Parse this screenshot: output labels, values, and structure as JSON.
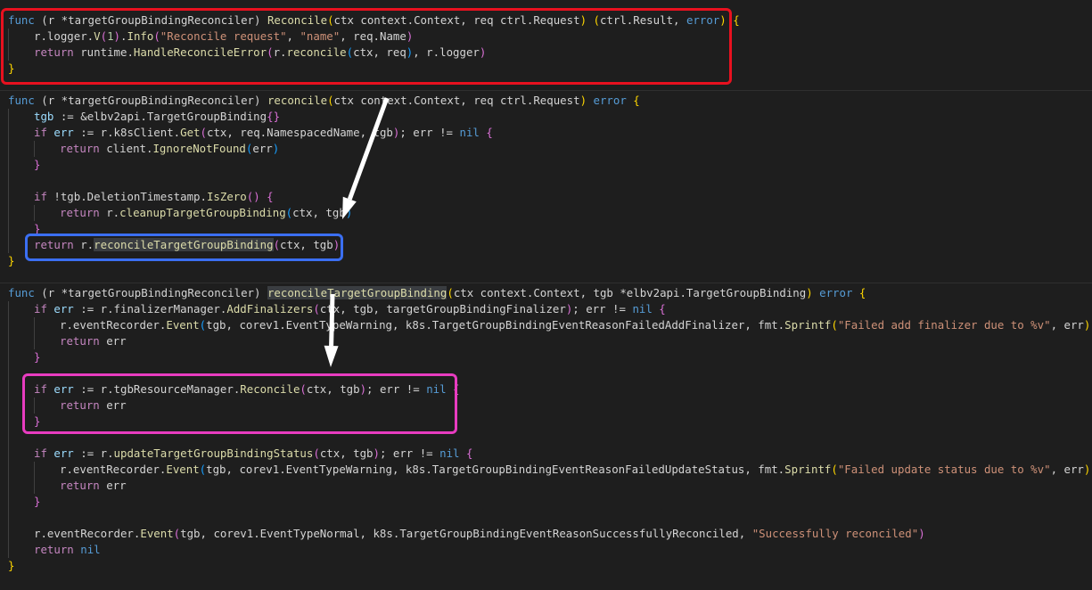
{
  "colors": {
    "background": "#1e1e1e",
    "keyword": "#569cd6",
    "control": "#c586c0",
    "function": "#dcdcaa",
    "string": "#ce9178",
    "number": "#b5cea8",
    "variable": "#9cdcfe",
    "text": "#d4d4d4",
    "red_box": "#e8111f",
    "blue_box": "#3b6ff2",
    "magenta_box": "#e83cc0",
    "arrow": "#ffffff"
  },
  "annotations": {
    "red_box": "highlights Reconcile method",
    "blue_box": "highlights return r.reconcileTargetGroupBinding(ctx, tgb)",
    "magenta_box": "highlights tgbResourceManager.Reconcile call",
    "arrow_icons": [
      "arrow-down-left-icon",
      "arrow-down-icon"
    ]
  },
  "lines": [
    {
      "indent": 0,
      "text": "func (r *targetGroupBindingReconciler) Reconcile(ctx context.Context, req ctrl.Request) (ctrl.Result, error) {",
      "tokens": [
        [
          "func",
          "kw"
        ],
        [
          " (r *targetGroupBindingReconciler) ",
          ""
        ],
        [
          "Reconcile",
          "fn"
        ],
        [
          "(",
          "b1"
        ],
        [
          "ctx context.Context, req ctrl.Request",
          ""
        ],
        [
          ")",
          "b1"
        ],
        [
          " ",
          ""
        ],
        [
          "(",
          "b1"
        ],
        [
          "ctrl.Result, ",
          ""
        ],
        [
          "error",
          "kw"
        ],
        [
          ")",
          "b1"
        ],
        [
          " ",
          ""
        ],
        [
          "{",
          "b1"
        ]
      ]
    },
    {
      "indent": 1,
      "text": "r.logger.V(1).Info(\"Reconcile request\", \"name\", req.Name)",
      "tokens": [
        [
          "r.logger.",
          ""
        ],
        [
          "V",
          "fn"
        ],
        [
          "(",
          "b2"
        ],
        [
          "1",
          "num"
        ],
        [
          ")",
          "b2"
        ],
        [
          ".",
          ""
        ],
        [
          "Info",
          "fn"
        ],
        [
          "(",
          "b2"
        ],
        [
          "\"Reconcile request\"",
          "str"
        ],
        [
          ", ",
          ""
        ],
        [
          "\"name\"",
          "str"
        ],
        [
          ", req.Name",
          ""
        ],
        [
          ")",
          "b2"
        ]
      ]
    },
    {
      "indent": 1,
      "text": "return runtime.HandleReconcileError(r.reconcile(ctx, req), r.logger)",
      "tokens": [
        [
          "return",
          "ctl"
        ],
        [
          " runtime.",
          ""
        ],
        [
          "HandleReconcileError",
          "fn"
        ],
        [
          "(",
          "b2"
        ],
        [
          "r.",
          ""
        ],
        [
          "reconcile",
          "fn"
        ],
        [
          "(",
          "b3"
        ],
        [
          "ctx, req",
          ""
        ],
        [
          ")",
          "b3"
        ],
        [
          ", r.logger",
          ""
        ],
        [
          ")",
          "b2"
        ]
      ]
    },
    {
      "indent": 0,
      "text": "}",
      "tokens": [
        [
          "}",
          "b1"
        ]
      ]
    },
    {
      "indent": 0,
      "text": "",
      "tokens": []
    },
    {
      "indent": 0,
      "text": "func (r *targetGroupBindingReconciler) reconcile(ctx context.Context, req ctrl.Request) error {",
      "tokens": [
        [
          "func",
          "kw"
        ],
        [
          " (r *targetGroupBindingReconciler) ",
          ""
        ],
        [
          "reconcile",
          "fn"
        ],
        [
          "(",
          "b1"
        ],
        [
          "ctx context.Context, req ctrl.Request",
          ""
        ],
        [
          ")",
          "b1"
        ],
        [
          " ",
          ""
        ],
        [
          "error",
          "kw"
        ],
        [
          " ",
          ""
        ],
        [
          "{",
          "b1"
        ]
      ]
    },
    {
      "indent": 1,
      "text": "tgb := &elbv2api.TargetGroupBinding{}",
      "tokens": [
        [
          "tgb",
          "var"
        ],
        [
          " := &elbv2api.TargetGroupBinding",
          ""
        ],
        [
          "{}",
          "b2"
        ]
      ]
    },
    {
      "indent": 1,
      "text": "if err := r.k8sClient.Get(ctx, req.NamespacedName, tgb); err != nil {",
      "tokens": [
        [
          "if",
          "ctl"
        ],
        [
          " ",
          ""
        ],
        [
          "err",
          "var"
        ],
        [
          " := r.k8sClient.",
          ""
        ],
        [
          "Get",
          "fn"
        ],
        [
          "(",
          "b2"
        ],
        [
          "ctx, req.NamespacedName, tgb",
          ""
        ],
        [
          ")",
          "b2"
        ],
        [
          "; err != ",
          ""
        ],
        [
          "nil",
          "kw"
        ],
        [
          " ",
          ""
        ],
        [
          "{",
          "b2"
        ]
      ]
    },
    {
      "indent": 2,
      "text": "return client.IgnoreNotFound(err)",
      "tokens": [
        [
          "return",
          "ctl"
        ],
        [
          " client.",
          ""
        ],
        [
          "IgnoreNotFound",
          "fn"
        ],
        [
          "(",
          "b3"
        ],
        [
          "err",
          ""
        ],
        [
          ")",
          "b3"
        ]
      ]
    },
    {
      "indent": 1,
      "text": "}",
      "tokens": [
        [
          "}",
          "b2"
        ]
      ]
    },
    {
      "indent": 1,
      "text": "",
      "tokens": []
    },
    {
      "indent": 1,
      "text": "if !tgb.DeletionTimestamp.IsZero() {",
      "tokens": [
        [
          "if",
          "ctl"
        ],
        [
          " !tgb.DeletionTimestamp.",
          ""
        ],
        [
          "IsZero",
          "fn"
        ],
        [
          "()",
          "b2"
        ],
        [
          " ",
          ""
        ],
        [
          "{",
          "b2"
        ]
      ]
    },
    {
      "indent": 2,
      "text": "return r.cleanupTargetGroupBinding(ctx, tgb)",
      "tokens": [
        [
          "return",
          "ctl"
        ],
        [
          " r.",
          ""
        ],
        [
          "cleanupTargetGroupBinding",
          "fn"
        ],
        [
          "(",
          "b3"
        ],
        [
          "ctx, tgb",
          ""
        ],
        [
          ")",
          "b3"
        ]
      ]
    },
    {
      "indent": 1,
      "text": "}",
      "tokens": [
        [
          "}",
          "b2"
        ]
      ]
    },
    {
      "indent": 1,
      "text": "return r.reconcileTargetGroupBinding(ctx, tgb)",
      "tokens": [
        [
          "return",
          "ctl"
        ],
        [
          " r.",
          ""
        ],
        [
          "reconcileTargetGroupBinding",
          "fn hl"
        ],
        [
          "(",
          "b2"
        ],
        [
          "ctx, tgb",
          ""
        ],
        [
          ")",
          "b2"
        ]
      ]
    },
    {
      "indent": 0,
      "text": "}",
      "tokens": [
        [
          "}",
          "b1"
        ]
      ]
    },
    {
      "indent": 0,
      "text": "",
      "tokens": []
    },
    {
      "indent": 0,
      "text": "func (r *targetGroupBindingReconciler) reconcileTargetGroupBinding(ctx context.Context, tgb *elbv2api.TargetGroupBinding) error {",
      "tokens": [
        [
          "func",
          "kw"
        ],
        [
          " (r *targetGroupBindingReconciler) ",
          ""
        ],
        [
          "reconcileTargetGroupBinding",
          "fn hl"
        ],
        [
          "(",
          "b1"
        ],
        [
          "ctx context.Context, tgb *elbv2api.TargetGroupBinding",
          ""
        ],
        [
          ")",
          "b1"
        ],
        [
          " ",
          ""
        ],
        [
          "error",
          "kw"
        ],
        [
          " ",
          ""
        ],
        [
          "{",
          "b1"
        ]
      ]
    },
    {
      "indent": 1,
      "text": "if err := r.finalizerManager.AddFinalizers(ctx, tgb, targetGroupBindingFinalizer); err != nil {",
      "tokens": [
        [
          "if",
          "ctl"
        ],
        [
          " ",
          ""
        ],
        [
          "err",
          "var"
        ],
        [
          " := r.finalizerManager.",
          ""
        ],
        [
          "AddFinalizers",
          "fn"
        ],
        [
          "(",
          "b2"
        ],
        [
          "ctx, tgb, targetGroupBindingFinalizer",
          ""
        ],
        [
          ")",
          "b2"
        ],
        [
          "; err != ",
          ""
        ],
        [
          "nil",
          "kw"
        ],
        [
          " ",
          ""
        ],
        [
          "{",
          "b2"
        ]
      ]
    },
    {
      "indent": 2,
      "text": "r.eventRecorder.Event(tgb, corev1.EventTypeWarning, k8s.TargetGroupBindingEventReasonFailedAddFinalizer, fmt.Sprintf(\"Failed add finalizer due to %v\", err))",
      "tokens": [
        [
          "r.eventRecorder.",
          ""
        ],
        [
          "Event",
          "fn"
        ],
        [
          "(",
          "b3"
        ],
        [
          "tgb, corev1.EventTypeWarning, k8s.TargetGroupBindingEventReasonFailedAddFinalizer, fmt.",
          ""
        ],
        [
          "Sprintf",
          "fn"
        ],
        [
          "(",
          "b1"
        ],
        [
          "\"Failed add finalizer due to %v\"",
          "str"
        ],
        [
          ", err",
          ""
        ],
        [
          ")",
          "b1"
        ],
        [
          ")",
          "b3"
        ]
      ]
    },
    {
      "indent": 2,
      "text": "return err",
      "tokens": [
        [
          "return",
          "ctl"
        ],
        [
          " err",
          ""
        ]
      ]
    },
    {
      "indent": 1,
      "text": "}",
      "tokens": [
        [
          "}",
          "b2"
        ]
      ]
    },
    {
      "indent": 1,
      "text": "",
      "tokens": []
    },
    {
      "indent": 1,
      "text": "if err := r.tgbResourceManager.Reconcile(ctx, tgb); err != nil {",
      "tokens": [
        [
          "if",
          "ctl"
        ],
        [
          " ",
          ""
        ],
        [
          "err",
          "var"
        ],
        [
          " := r.tgbResourceManager.",
          ""
        ],
        [
          "Reconcile",
          "fn"
        ],
        [
          "(",
          "b2"
        ],
        [
          "ctx, tgb",
          ""
        ],
        [
          ")",
          "b2"
        ],
        [
          "; err != ",
          ""
        ],
        [
          "nil",
          "kw"
        ],
        [
          " ",
          ""
        ],
        [
          "{",
          "b2"
        ]
      ]
    },
    {
      "indent": 2,
      "text": "return err",
      "tokens": [
        [
          "return",
          "ctl"
        ],
        [
          " err",
          ""
        ]
      ]
    },
    {
      "indent": 1,
      "text": "}",
      "tokens": [
        [
          "}",
          "b2"
        ]
      ]
    },
    {
      "indent": 1,
      "text": "",
      "tokens": []
    },
    {
      "indent": 1,
      "text": "if err := r.updateTargetGroupBindingStatus(ctx, tgb); err != nil {",
      "tokens": [
        [
          "if",
          "ctl"
        ],
        [
          " ",
          ""
        ],
        [
          "err",
          "var"
        ],
        [
          " := r.",
          ""
        ],
        [
          "updateTargetGroupBindingStatus",
          "fn"
        ],
        [
          "(",
          "b2"
        ],
        [
          "ctx, tgb",
          ""
        ],
        [
          ")",
          "b2"
        ],
        [
          "; err != ",
          ""
        ],
        [
          "nil",
          "kw"
        ],
        [
          " ",
          ""
        ],
        [
          "{",
          "b2"
        ]
      ]
    },
    {
      "indent": 2,
      "text": "r.eventRecorder.Event(tgb, corev1.EventTypeWarning, k8s.TargetGroupBindingEventReasonFailedUpdateStatus, fmt.Sprintf(\"Failed update status due to %v\", err))",
      "tokens": [
        [
          "r.eventRecorder.",
          ""
        ],
        [
          "Event",
          "fn"
        ],
        [
          "(",
          "b3"
        ],
        [
          "tgb, corev1.EventTypeWarning, k8s.TargetGroupBindingEventReasonFailedUpdateStatus, fmt.",
          ""
        ],
        [
          "Sprintf",
          "fn"
        ],
        [
          "(",
          "b1"
        ],
        [
          "\"Failed update status due to %v\"",
          "str"
        ],
        [
          ", err",
          ""
        ],
        [
          ")",
          "b1"
        ],
        [
          ")",
          "b3"
        ]
      ]
    },
    {
      "indent": 2,
      "text": "return err",
      "tokens": [
        [
          "return",
          "ctl"
        ],
        [
          " err",
          ""
        ]
      ]
    },
    {
      "indent": 1,
      "text": "}",
      "tokens": [
        [
          "}",
          "b2"
        ]
      ]
    },
    {
      "indent": 1,
      "text": "",
      "tokens": []
    },
    {
      "indent": 1,
      "text": "r.eventRecorder.Event(tgb, corev1.EventTypeNormal, k8s.TargetGroupBindingEventReasonSuccessfullyReconciled, \"Successfully reconciled\")",
      "tokens": [
        [
          "r.eventRecorder.",
          ""
        ],
        [
          "Event",
          "fn"
        ],
        [
          "(",
          "b2"
        ],
        [
          "tgb, corev1.EventTypeNormal, k8s.TargetGroupBindingEventReasonSuccessfullyReconciled, ",
          ""
        ],
        [
          "\"Successfully reconciled\"",
          "str"
        ],
        [
          ")",
          "b2"
        ]
      ]
    },
    {
      "indent": 1,
      "text": "return nil",
      "tokens": [
        [
          "return",
          "ctl"
        ],
        [
          " ",
          ""
        ],
        [
          "nil",
          "kw"
        ]
      ]
    },
    {
      "indent": 0,
      "text": "}",
      "tokens": [
        [
          "}",
          "b1"
        ]
      ]
    }
  ]
}
